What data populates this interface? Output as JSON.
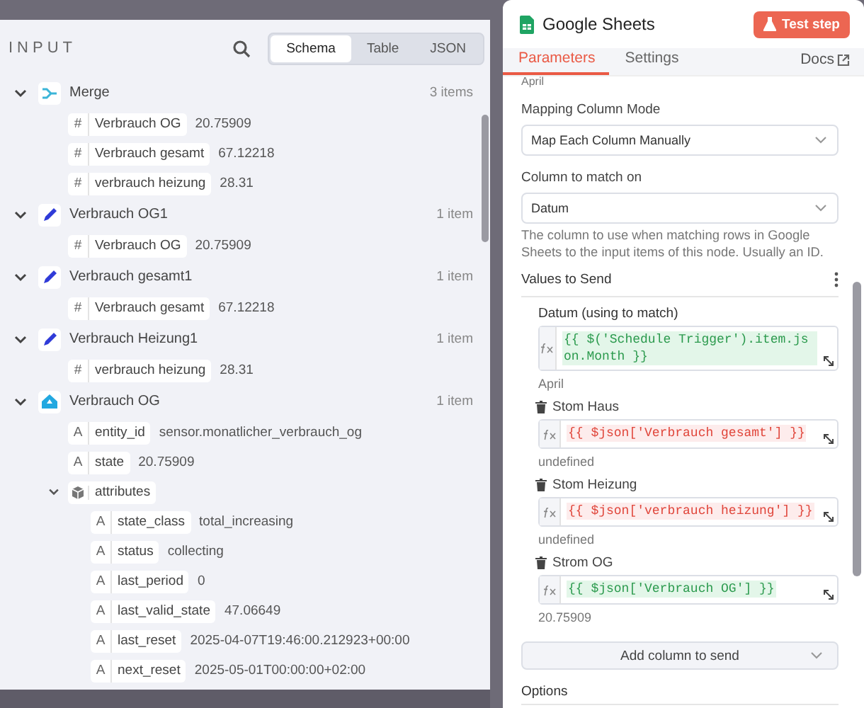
{
  "input_panel": {
    "title": "INPUT",
    "view_tabs": [
      {
        "label": "Schema",
        "selected": true
      },
      {
        "label": "Table",
        "selected": false
      },
      {
        "label": "JSON",
        "selected": false
      }
    ],
    "nodes": [
      {
        "kind": "merge",
        "name": "Merge",
        "count": "3 items",
        "expanded": true,
        "fields": [
          {
            "kind": "number",
            "glyph": "#",
            "key": "Verbrauch OG",
            "value": "20.75909"
          },
          {
            "kind": "number",
            "glyph": "#",
            "key": "Verbrauch gesamt",
            "value": "67.12218"
          },
          {
            "kind": "number",
            "glyph": "#",
            "key": "verbrauch heizung",
            "value": "28.31"
          }
        ]
      },
      {
        "kind": "edit",
        "name": "Verbrauch OG1",
        "count": "1 item",
        "expanded": true,
        "fields": [
          {
            "kind": "number",
            "glyph": "#",
            "key": "Verbrauch OG",
            "value": "20.75909"
          }
        ]
      },
      {
        "kind": "edit",
        "name": "Verbrauch gesamt1",
        "count": "1 item",
        "expanded": true,
        "fields": [
          {
            "kind": "number",
            "glyph": "#",
            "key": "Verbrauch gesamt",
            "value": "67.12218"
          }
        ]
      },
      {
        "kind": "edit",
        "name": "Verbrauch Heizung1",
        "count": "1 item",
        "expanded": true,
        "fields": [
          {
            "kind": "number",
            "glyph": "#",
            "key": "verbrauch heizung",
            "value": "28.31"
          }
        ]
      },
      {
        "kind": "home",
        "name": "Verbrauch OG",
        "count": "1 item",
        "expanded": true,
        "fields": [
          {
            "kind": "string",
            "glyph": "A",
            "key": "entity_id",
            "value": "sensor.monatlicher_verbrauch_og"
          },
          {
            "kind": "string",
            "glyph": "A",
            "key": "state",
            "value": "20.75909"
          },
          {
            "kind": "object",
            "key": "attributes",
            "expanded": true,
            "children": [
              {
                "kind": "string",
                "glyph": "A",
                "key": "state_class",
                "value": "total_increasing"
              },
              {
                "kind": "string",
                "glyph": "A",
                "key": "status",
                "value": "collecting"
              },
              {
                "kind": "string",
                "glyph": "A",
                "key": "last_period",
                "value": "0"
              },
              {
                "kind": "string",
                "glyph": "A",
                "key": "last_valid_state",
                "value": "47.06649"
              },
              {
                "kind": "string",
                "glyph": "A",
                "key": "last_reset",
                "value": "2025-04-07T19:46:00.212923+00:00"
              },
              {
                "kind": "string",
                "glyph": "A",
                "key": "next_reset",
                "value": "2025-05-01T00:00:00+02:00"
              }
            ]
          }
        ]
      }
    ]
  },
  "node_panel": {
    "title": "Google Sheets",
    "test_button": "Test step",
    "tabs": [
      {
        "label": "Parameters",
        "selected": true
      },
      {
        "label": "Settings",
        "selected": false
      }
    ],
    "docs_link": "Docs",
    "cut_text": "April",
    "mapping_mode": {
      "label": "Mapping Column Mode",
      "value": "Map Each Column Manually"
    },
    "match_column": {
      "label": "Column to match on",
      "value": "Datum",
      "hint": "The column to use when matching rows in Google Sheets to the input items of this node. Usually an ID."
    },
    "values_section": {
      "title": "Values to Send",
      "values": [
        {
          "label": "Datum (using to match)",
          "deletable": false,
          "valid": true,
          "expression": "{{ $('Schedule Trigger').item.json.Month }}",
          "result": "April"
        },
        {
          "label": "Stom Haus",
          "deletable": true,
          "valid": false,
          "expression": "{{ $json['Verbrauch gesamt'] }}",
          "result": "undefined"
        },
        {
          "label": "Stom Heizung",
          "deletable": true,
          "valid": false,
          "expression": "{{ $json['verbrauch heizung'] }}",
          "result": "undefined"
        },
        {
          "label": "Strom OG",
          "deletable": true,
          "valid": true,
          "expression": "{{ $json['Verbrauch OG'] }}",
          "result": "20.75909"
        }
      ],
      "add_button": "Add column to send"
    },
    "options_title": "Options"
  }
}
